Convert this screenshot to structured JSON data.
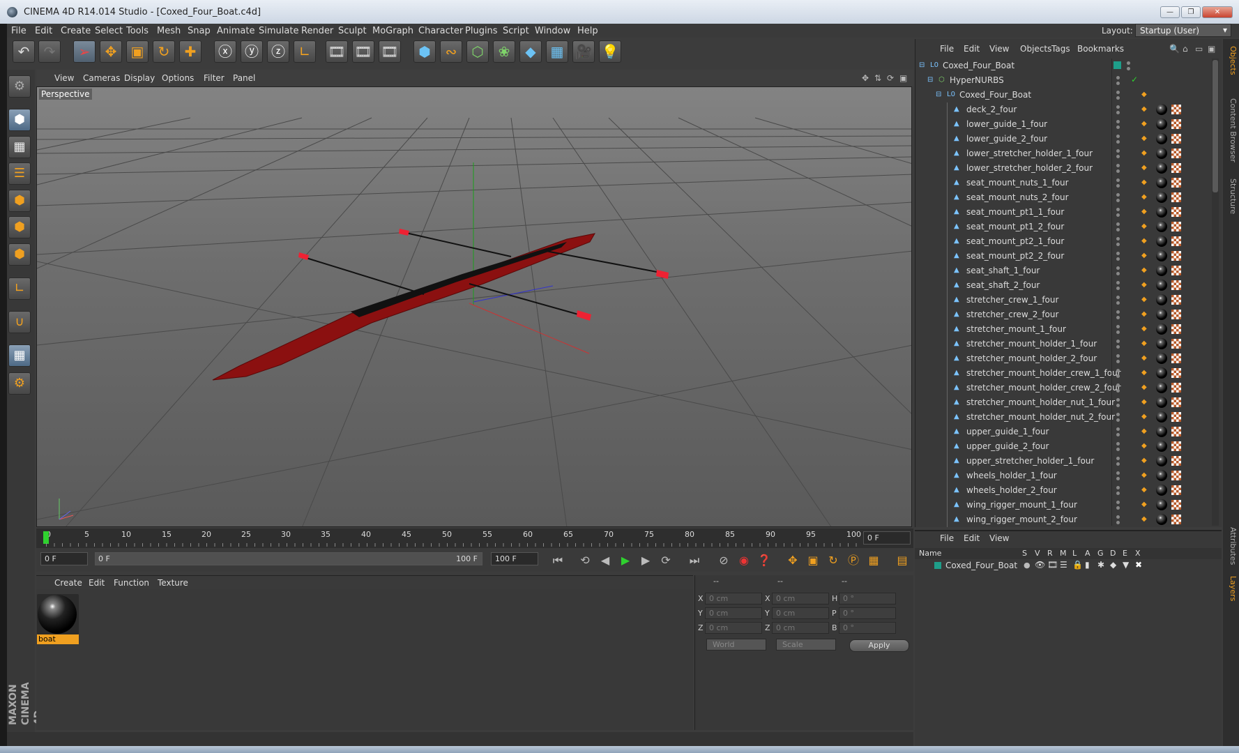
{
  "window": {
    "title": "CINEMA 4D R14.014 Studio - [Coxed_Four_Boat.c4d]"
  },
  "menu": [
    "File",
    "Edit",
    "Create",
    "Select",
    "Tools",
    "Mesh",
    "Snap",
    "Animate",
    "Simulate",
    "Render",
    "Sculpt",
    "MoGraph",
    "Character",
    "Plugins",
    "Script",
    "Window",
    "Help"
  ],
  "layout": {
    "label": "Layout:",
    "value": "Startup (User)"
  },
  "viewport": {
    "menu": [
      "View",
      "Cameras",
      "Display",
      "Options",
      "Filter",
      "Panel"
    ],
    "label": "Perspective"
  },
  "timeline": {
    "ticks": [
      "0",
      "5",
      "10",
      "15",
      "20",
      "25",
      "30",
      "35",
      "40",
      "45",
      "50",
      "55",
      "60",
      "65",
      "70",
      "75",
      "80",
      "85",
      "90",
      "95",
      "100"
    ],
    "current_frame": "0 F",
    "start": "0 F",
    "range_start": "0 F",
    "range_end": "100 F",
    "end": "100 F"
  },
  "material_manager": {
    "menu": [
      "Create",
      "Edit",
      "Function",
      "Texture"
    ],
    "materials": [
      {
        "name": "boat"
      }
    ]
  },
  "coordinates": {
    "headers": [
      "--",
      "--",
      "--"
    ],
    "rows": [
      {
        "a": "X",
        "av": "0 cm",
        "b": "X",
        "bv": "0 cm",
        "c": "H",
        "cv": "0 °"
      },
      {
        "a": "Y",
        "av": "0 cm",
        "b": "Y",
        "bv": "0 cm",
        "c": "P",
        "cv": "0 °"
      },
      {
        "a": "Z",
        "av": "0 cm",
        "b": "Z",
        "bv": "0 cm",
        "c": "B",
        "cv": "0 °"
      }
    ],
    "space": "World",
    "mode": "Scale",
    "apply": "Apply"
  },
  "object_manager": {
    "menu": [
      "File",
      "Edit",
      "View",
      "Objects",
      "Tags",
      "Bookmarks"
    ],
    "root": "Coxed_Four_Boat",
    "nurbs": "HyperNURBS",
    "group": "Coxed_Four_Boat",
    "children": [
      "deck_2_four",
      "lower_guide_1_four",
      "lower_guide_2_four",
      "lower_stretcher_holder_1_four",
      "lower_stretcher_holder_2_four",
      "seat_mount_nuts_1_four",
      "seat_mount_nuts_2_four",
      "seat_mount_pt1_1_four",
      "seat_mount_pt1_2_four",
      "seat_mount_pt2_1_four",
      "seat_mount_pt2_2_four",
      "seat_shaft_1_four",
      "seat_shaft_2_four",
      "stretcher_crew_1_four",
      "stretcher_crew_2_four",
      "stretcher_mount_1_four",
      "stretcher_mount_holder_1_four",
      "stretcher_mount_holder_2_four",
      "stretcher_mount_holder_crew_1_four",
      "stretcher_mount_holder_crew_2_four",
      "stretcher_mount_holder_nut_1_four",
      "stretcher_mount_holder_nut_2_four",
      "upper_guide_1_four",
      "upper_guide_2_four",
      "upper_stretcher_holder_1_four",
      "wheels_holder_1_four",
      "wheels_holder_2_four",
      "wing_rigger_mount_1_four",
      "wing_rigger_mount_2_four"
    ]
  },
  "layer_manager": {
    "menu": [
      "File",
      "Edit",
      "View"
    ],
    "columns": [
      "Name",
      "S",
      "V",
      "R",
      "M",
      "L",
      "A",
      "G",
      "D",
      "E",
      "X"
    ],
    "layers": [
      {
        "name": "Coxed_Four_Boat",
        "color": "#1e9e8a"
      }
    ]
  },
  "right_tabs": [
    "Objects",
    "Content Browser",
    "Structure",
    "Attributes",
    "Layers"
  ],
  "colors": {
    "accent": "#f0a020",
    "boat_hull": "#8b1010",
    "layer_color": "#1e9e8a"
  }
}
